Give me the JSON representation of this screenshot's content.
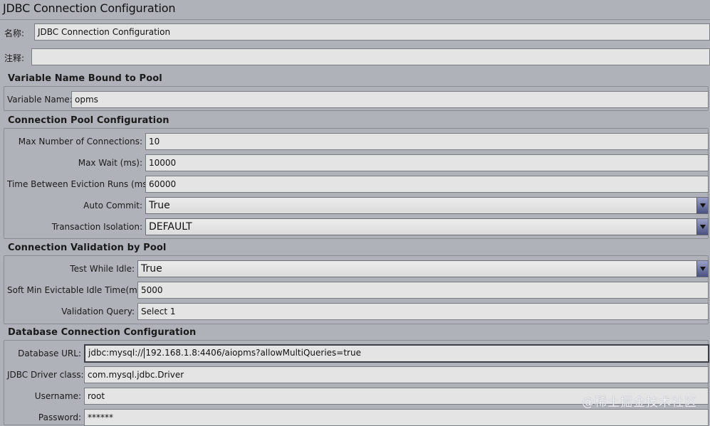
{
  "window": {
    "title": "JDBC Connection Configuration"
  },
  "general": {
    "name_label": "名称:",
    "name_value": "JDBC Connection Configuration",
    "comment_label": "注释:",
    "comment_value": ""
  },
  "pool_binding": {
    "title": "Variable Name Bound to Pool",
    "variable_label": "Variable Name:",
    "variable_value": "opms"
  },
  "pool_config": {
    "title": "Connection Pool Configuration",
    "max_conn_label": "Max Number of Connections:",
    "max_conn_value": "10",
    "max_wait_label": "Max Wait (ms):",
    "max_wait_value": "10000",
    "eviction_label": "Time Between Eviction Runs (ms):",
    "eviction_value": "60000",
    "auto_commit_label": "Auto Commit:",
    "auto_commit_value": "True",
    "isolation_label": "Transaction Isolation:",
    "isolation_value": "DEFAULT"
  },
  "validation": {
    "title": "Connection Validation by Pool",
    "test_idle_label": "Test While Idle:",
    "test_idle_value": "True",
    "soft_min_label": "Soft Min Evictable Idle Time(ms):",
    "soft_min_value": "5000",
    "query_label": "Validation Query:",
    "query_value": "Select 1"
  },
  "database": {
    "title": "Database Connection Configuration",
    "url_label": "Database URL:",
    "url_prefix": "jdbc:mysql://",
    "url_suffix": "192.168.1.8:4406/aiopms?allowMultiQueries=true",
    "driver_label": "JDBC Driver class:",
    "driver_value": "com.mysql.jdbc.Driver",
    "username_label": "Username:",
    "username_value": "root",
    "password_label": "Password:",
    "password_value": "******"
  },
  "watermark": "@稀土掘金技术社区",
  "icons": {
    "dropdown": "chevron-down-icon"
  }
}
